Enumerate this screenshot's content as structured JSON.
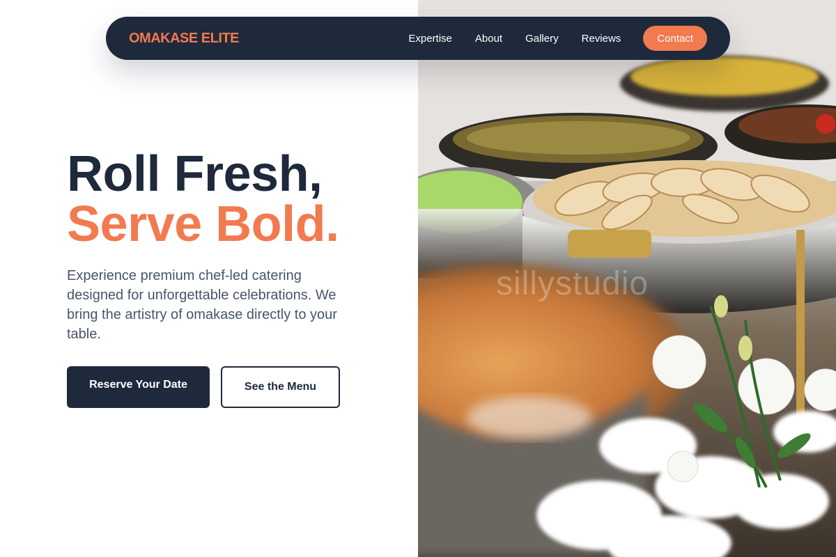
{
  "brand": {
    "name": "OMAKASE ELITE",
    "color": "#f27a4f"
  },
  "nav": {
    "links": [
      "Expertise",
      "About",
      "Gallery",
      "Reviews"
    ],
    "contact_label": "Contact"
  },
  "hero": {
    "headline_line1": "Roll Fresh,",
    "headline_line2": "Serve Bold.",
    "lead": "Experience premium chef-led catering designed for unforgettable celebrations. We bring the artistry of omakase directly to your table.",
    "primary_cta": "Reserve Your Date",
    "secondary_cta": "See the Menu",
    "image_watermark": "sillystudio"
  },
  "colors": {
    "navy": "#1e293b",
    "accent": "#f27a4f",
    "body_text": "#475569"
  }
}
